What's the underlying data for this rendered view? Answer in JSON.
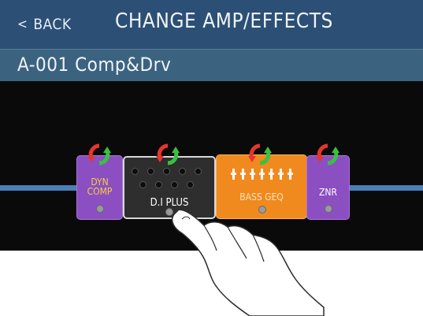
{
  "header": {
    "back_chevron": "<",
    "back_label": "BACK",
    "title": "CHANGE AMP/EFFECTS"
  },
  "patch": {
    "name": "A-001 Comp&Drv"
  },
  "effects_chain": [
    {
      "name": "DYN COMP",
      "label": "DYN\nCOMP",
      "color": "#8b4fc2",
      "label_color": "#f3cf3e",
      "selected": false
    },
    {
      "name": "DJ PLUS",
      "label": "D.I PLUS",
      "color": "#2e2e2e",
      "label_color": "#ffffff",
      "selected": true
    },
    {
      "name": "BASS GEQ",
      "label": "BASS GEQ",
      "color": "#f08a1e",
      "label_color": "#ffe2bd",
      "selected": false
    },
    {
      "name": "ZNR",
      "label": "ZNR",
      "color": "#8b4fc2",
      "label_color": "#ffffff",
      "selected": false
    }
  ],
  "icons": {
    "change_effect": "rotate-arrows-icon",
    "gesture": "pointing-hand-icon"
  },
  "colors": {
    "header_bg": "#2c4f75",
    "patch_bar_bg": "#3b6380",
    "screen_bg": "#0a0a0a",
    "cable": "#4a7fb8",
    "arrow_red": "#e5352e",
    "arrow_green": "#3ac041"
  }
}
